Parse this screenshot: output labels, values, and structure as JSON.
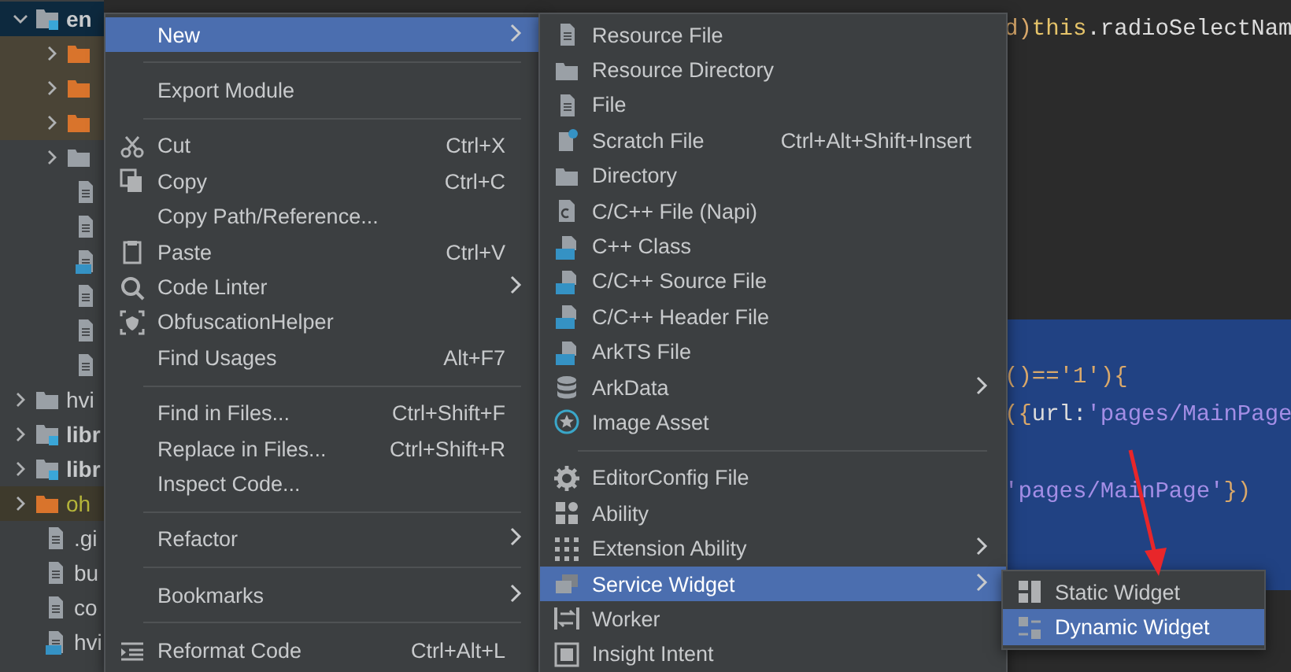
{
  "project_tree": [
    {
      "label": "en",
      "kind": "module",
      "expanded": true,
      "selected": true,
      "children": [
        {
          "kind": "excluded-folder",
          "expanded": false
        },
        {
          "kind": "excluded-folder",
          "expanded": false
        },
        {
          "kind": "excluded-folder",
          "expanded": false
        },
        {
          "kind": "folder",
          "expanded": false
        },
        {
          "kind": "file"
        },
        {
          "kind": "file"
        },
        {
          "kind": "ts-file"
        },
        {
          "kind": "file"
        },
        {
          "kind": "file"
        },
        {
          "kind": "file"
        }
      ]
    },
    {
      "label": "hvi",
      "kind": "folder",
      "expanded": false,
      "selected": false
    },
    {
      "label": "libr",
      "kind": "module",
      "expanded": false,
      "selected": false
    },
    {
      "label": "libr",
      "kind": "module",
      "expanded": false,
      "selected": false
    },
    {
      "label": "oh",
      "kind": "excluded-folder",
      "expanded": false,
      "selected": false
    },
    {
      "label": ".gi",
      "kind": "file",
      "selected": false
    },
    {
      "label": "bu",
      "kind": "file",
      "selected": false
    },
    {
      "label": "co",
      "kind": "file",
      "selected": false
    },
    {
      "label": "hvi",
      "kind": "ts-file",
      "selected": false
    }
  ],
  "editor": {
    "lines": [
      {
        "selected": false,
        "tokens": [
          {
            "text": "d)",
            "kind": "punct"
          },
          {
            "text": "this",
            "kind": "keyword"
          },
          {
            "text": ".radioSelectNam",
            "kind": "plain"
          }
        ]
      },
      {
        "selected": false
      },
      {
        "selected": false
      },
      {
        "selected": false
      },
      {
        "selected": false
      },
      {
        "selected": false
      },
      {
        "selected": false
      },
      {
        "selected": false
      },
      {
        "selected": true
      },
      {
        "selected": true,
        "tokens": [
          {
            "text": "()==",
            "kind": "punct"
          },
          {
            "text": "'1'",
            "kind": "punct"
          },
          {
            "text": "){",
            "kind": "punct"
          }
        ]
      },
      {
        "selected": true,
        "tokens": [
          {
            "text": "({",
            "kind": "punct"
          },
          {
            "text": "url:",
            "kind": "plain"
          },
          {
            "text": "'pages/MainPage",
            "kind": "string"
          }
        ]
      },
      {
        "selected": true
      },
      {
        "selected": true,
        "tokens": [
          {
            "text": "'pages/MainPage'",
            "kind": "string"
          },
          {
            "text": "})",
            "kind": "punct"
          }
        ]
      },
      {
        "selected": true
      },
      {
        "selected": true
      },
      {
        "selected": false
      }
    ]
  },
  "context_menu": [
    {
      "kind": "item",
      "label": "New",
      "submenu": true,
      "selected": true
    },
    {
      "kind": "separator"
    },
    {
      "kind": "item",
      "label": "Export Module",
      "submenu": false,
      "selected": false
    },
    {
      "kind": "separator"
    },
    {
      "kind": "item",
      "label": "Cut",
      "shortcut": "Ctrl+X",
      "submenu": false,
      "selected": false
    },
    {
      "kind": "item",
      "label": "Copy",
      "shortcut": "Ctrl+C",
      "submenu": false,
      "selected": false
    },
    {
      "kind": "item",
      "label": "Copy Path/Reference...",
      "submenu": false,
      "selected": false
    },
    {
      "kind": "item",
      "label": "Paste",
      "shortcut": "Ctrl+V",
      "submenu": false,
      "selected": false
    },
    {
      "kind": "item",
      "label": "Code Linter",
      "submenu": true,
      "selected": false
    },
    {
      "kind": "item",
      "label": "ObfuscationHelper",
      "submenu": false,
      "selected": false
    },
    {
      "kind": "item",
      "label": "Find Usages",
      "shortcut": "Alt+F7",
      "submenu": false,
      "selected": false
    },
    {
      "kind": "separator"
    },
    {
      "kind": "item",
      "label": "Find in Files...",
      "shortcut": "Ctrl+Shift+F",
      "submenu": false,
      "selected": false
    },
    {
      "kind": "item",
      "label": "Replace in Files...",
      "shortcut": "Ctrl+Shift+R",
      "submenu": false,
      "selected": false
    },
    {
      "kind": "item",
      "label": "Inspect Code...",
      "submenu": false,
      "selected": false
    },
    {
      "kind": "separator"
    },
    {
      "kind": "item",
      "label": "Refactor",
      "submenu": true,
      "selected": false
    },
    {
      "kind": "separator"
    },
    {
      "kind": "item",
      "label": "Bookmarks",
      "submenu": true,
      "selected": false
    },
    {
      "kind": "separator"
    },
    {
      "kind": "item",
      "label": "Reformat Code",
      "shortcut": "Ctrl+Alt+L",
      "submenu": false,
      "selected": false
    }
  ],
  "new_submenu": [
    {
      "kind": "item",
      "label": "Resource File",
      "submenu": false,
      "selected": false
    },
    {
      "kind": "item",
      "label": "Resource Directory",
      "submenu": false,
      "selected": false
    },
    {
      "kind": "item",
      "label": "File",
      "submenu": false,
      "selected": false
    },
    {
      "kind": "item",
      "label": "Scratch File",
      "shortcut": "Ctrl+Alt+Shift+Insert",
      "submenu": false,
      "selected": false
    },
    {
      "kind": "item",
      "label": "Directory",
      "submenu": false,
      "selected": false
    },
    {
      "kind": "item",
      "label": "C/C++ File (Napi)",
      "submenu": false,
      "selected": false
    },
    {
      "kind": "item",
      "label": "C++ Class",
      "submenu": false,
      "selected": false
    },
    {
      "kind": "item",
      "label": "C/C++ Source File",
      "submenu": false,
      "selected": false
    },
    {
      "kind": "item",
      "label": "C/C++ Header File",
      "submenu": false,
      "selected": false
    },
    {
      "kind": "item",
      "label": "ArkTS File",
      "submenu": false,
      "selected": false
    },
    {
      "kind": "item",
      "label": "ArkData",
      "submenu": true,
      "selected": false
    },
    {
      "kind": "item",
      "label": "Image Asset",
      "submenu": false,
      "selected": false
    },
    {
      "kind": "separator"
    },
    {
      "kind": "item",
      "label": "EditorConfig File",
      "submenu": false,
      "selected": false
    },
    {
      "kind": "item",
      "label": "Ability",
      "submenu": false,
      "selected": false
    },
    {
      "kind": "item",
      "label": "Extension Ability",
      "submenu": true,
      "selected": false
    },
    {
      "kind": "item",
      "label": "Service Widget",
      "submenu": true,
      "selected": true
    },
    {
      "kind": "item",
      "label": "Worker",
      "submenu": false,
      "selected": false
    },
    {
      "kind": "item",
      "label": "Insight Intent",
      "submenu": false,
      "selected": false
    }
  ],
  "widget_submenu": [
    {
      "kind": "item",
      "label": "Static Widget",
      "submenu": false,
      "selected": false
    },
    {
      "kind": "item",
      "label": "Dynamic Widget",
      "submenu": false,
      "selected": true
    }
  ]
}
